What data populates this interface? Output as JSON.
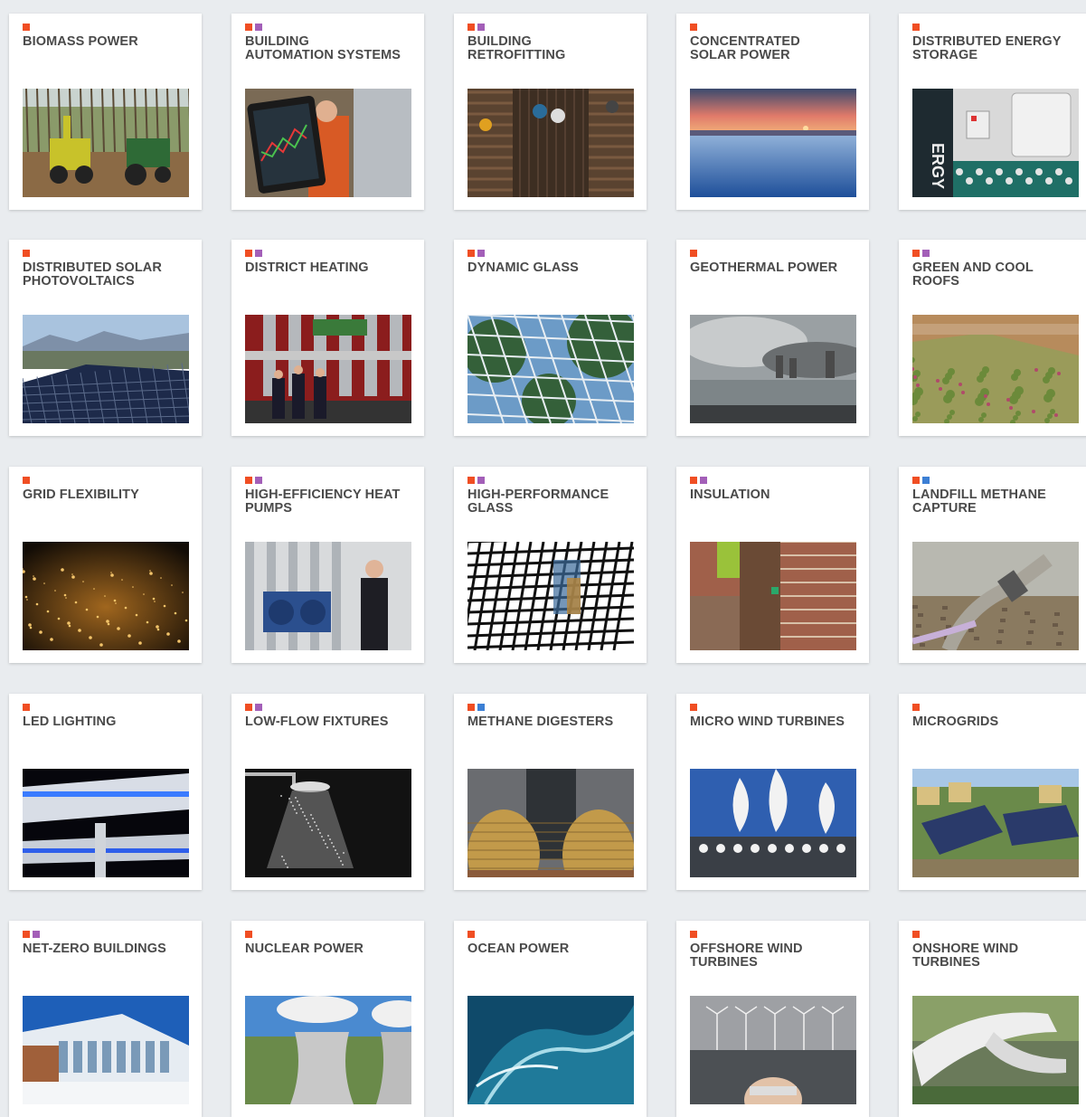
{
  "colors": {
    "page_background": "#e9ecef",
    "card_background": "#ffffff",
    "title_text": "#4a4a4a",
    "tag_colors": {
      "orange": "#f04e23",
      "purple": "#a35fb8",
      "blue": "#3c7fd4"
    }
  },
  "cards": [
    {
      "title": "BIOMASS POWER",
      "tags": [
        "orange"
      ],
      "image": "biomass-harvest-photo"
    },
    {
      "title": "BUILDING\nAUTOMATION SYSTEMS",
      "tags": [
        "orange",
        "purple"
      ],
      "image": "tablet-control-photo"
    },
    {
      "title": "BUILDING\nRETROFITTING",
      "tags": [
        "orange",
        "purple"
      ],
      "image": "retrofit-stairwell-photo"
    },
    {
      "title": "CONCENTRATED\nSOLAR POWER",
      "tags": [
        "orange"
      ],
      "image": "solar-field-sunset-photo"
    },
    {
      "title": "DISTRIBUTED ENERGY\nSTORAGE",
      "tags": [
        "orange"
      ],
      "image": "home-battery-photo"
    },
    {
      "title": "DISTRIBUTED SOLAR\nPHOTOVOLTAICS",
      "tags": [
        "orange"
      ],
      "image": "rooftop-solar-photo"
    },
    {
      "title": "DISTRICT HEATING",
      "tags": [
        "orange",
        "purple"
      ],
      "image": "heating-plant-photo"
    },
    {
      "title": "DYNAMIC GLASS",
      "tags": [
        "orange",
        "purple"
      ],
      "image": "glass-atrium-photo"
    },
    {
      "title": "GEOTHERMAL POWER",
      "tags": [
        "orange"
      ],
      "image": "geothermal-steam-photo"
    },
    {
      "title": "GREEN AND COOL\nROOFS",
      "tags": [
        "orange",
        "purple"
      ],
      "image": "green-roof-photo"
    },
    {
      "title": "GRID FLEXIBILITY",
      "tags": [
        "orange"
      ],
      "image": "city-lights-night-photo"
    },
    {
      "title": "HIGH-EFFICIENCY HEAT\nPUMPS",
      "tags": [
        "orange",
        "purple"
      ],
      "image": "heat-pump-room-photo"
    },
    {
      "title": "HIGH-PERFORMANCE\nGLASS",
      "tags": [
        "orange",
        "purple"
      ],
      "image": "glass-lattice-photo"
    },
    {
      "title": "INSULATION",
      "tags": [
        "orange",
        "purple"
      ],
      "image": "brick-insulation-photo"
    },
    {
      "title": "LANDFILL METHANE\nCAPTURE",
      "tags": [
        "orange",
        "blue"
      ],
      "image": "landfill-pipe-photo"
    },
    {
      "title": "LED LIGHTING",
      "tags": [
        "orange"
      ],
      "image": "led-canopy-photo"
    },
    {
      "title": "LOW-FLOW FIXTURES",
      "tags": [
        "orange",
        "purple"
      ],
      "image": "shower-head-photo"
    },
    {
      "title": "METHANE DIGESTERS",
      "tags": [
        "orange",
        "blue"
      ],
      "image": "digester-eggs-photo"
    },
    {
      "title": "MICRO WIND TURBINES",
      "tags": [
        "orange"
      ],
      "image": "vertical-turbines-photo"
    },
    {
      "title": "MICROGRIDS",
      "tags": [
        "orange"
      ],
      "image": "solar-neighborhood-photo"
    },
    {
      "title": "NET-ZERO BUILDINGS",
      "tags": [
        "orange",
        "purple"
      ],
      "image": "modern-building-photo"
    },
    {
      "title": "NUCLEAR POWER",
      "tags": [
        "orange"
      ],
      "image": "cooling-towers-photo"
    },
    {
      "title": "OCEAN POWER",
      "tags": [
        "orange"
      ],
      "image": "ocean-wave-photo"
    },
    {
      "title": "OFFSHORE WIND\nTURBINES",
      "tags": [
        "orange"
      ],
      "image": "offshore-wind-photo"
    },
    {
      "title": "ONSHORE WIND\nTURBINES",
      "tags": [
        "orange"
      ],
      "image": "wind-blade-photo"
    }
  ]
}
